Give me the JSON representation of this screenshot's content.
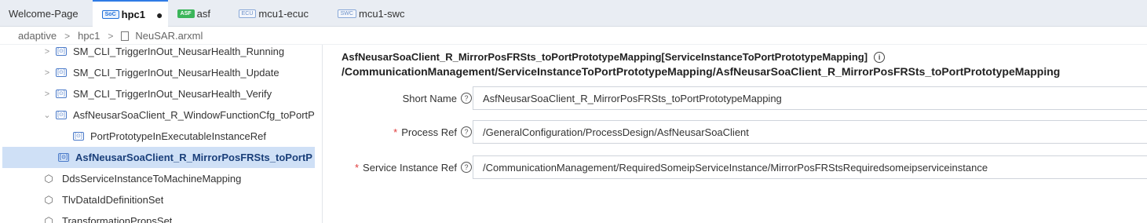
{
  "tabs": [
    {
      "label": "Welcome-Page",
      "badge": ""
    },
    {
      "label": "hpc1",
      "badge": "SoC",
      "active": true,
      "modified": "●"
    },
    {
      "label": "asf",
      "badge": "ASF"
    },
    {
      "label": "mcu1-ecuc",
      "badge": "ECU"
    },
    {
      "label": "mcu1-swc",
      "badge": "SWC"
    }
  ],
  "breadcrumb": [
    "adaptive",
    "hpc1",
    "NeuSAR.arxml"
  ],
  "breadcrumb_sep": ">",
  "tree": {
    "item_badge": "[⊙]",
    "expand_glyph": ">",
    "collapse_glyph": "⌄",
    "items": [
      {
        "label": "SM_CLI_TriggerInOut_NeusarHealth_Running"
      },
      {
        "label": "SM_CLI_TriggerInOut_NeusarHealth_Update"
      },
      {
        "label": "SM_CLI_TriggerInOut_NeusarHealth_Verify"
      },
      {
        "label": "AsfNeusarSoaClient_R_WindowFunctionCfg_toPortP"
      },
      {
        "label": "PortPrototypeInExecutableInstanceRef"
      },
      {
        "label": "AsfNeusarSoaClient_R_MirrorPosFRSts_toPortP"
      },
      {
        "label": "DdsServiceInstanceToMachineMapping"
      },
      {
        "label": "TlvDataIdDefinitionSet"
      },
      {
        "label": "TransformationPropsSet"
      }
    ]
  },
  "detail": {
    "title": "AsfNeusarSoaClient_R_MirrorPosFRSts_toPortPrototypeMapping[ServiceInstanceToPortPrototypeMapping]",
    "path": "/CommunicationManagement/ServiceInstanceToPortPrototypeMapping/AsfNeusarSoaClient_R_MirrorPosFRSts_toPortPrototypeMapping",
    "info_glyph": "i",
    "help_glyph": "?",
    "required_mark": "*",
    "fields": [
      {
        "label": "Short Name",
        "required": false,
        "value": "AsfNeusarSoaClient_R_MirrorPosFRSts_toPortPrototypeMapping"
      },
      {
        "label": "Process Ref",
        "required": true,
        "value": "/GeneralConfiguration/ProcessDesign/AsfNeusarSoaClient"
      },
      {
        "label": "Service Instance Ref",
        "required": true,
        "value": "/CommunicationManagement/RequiredSomeipServiceInstance/MirrorPosFRStsRequiredsomeipserviceinstance"
      }
    ]
  },
  "colors": {
    "accent": "#2f7be5",
    "selected_row": "#cfe0f6",
    "required": "#e03a3a"
  }
}
